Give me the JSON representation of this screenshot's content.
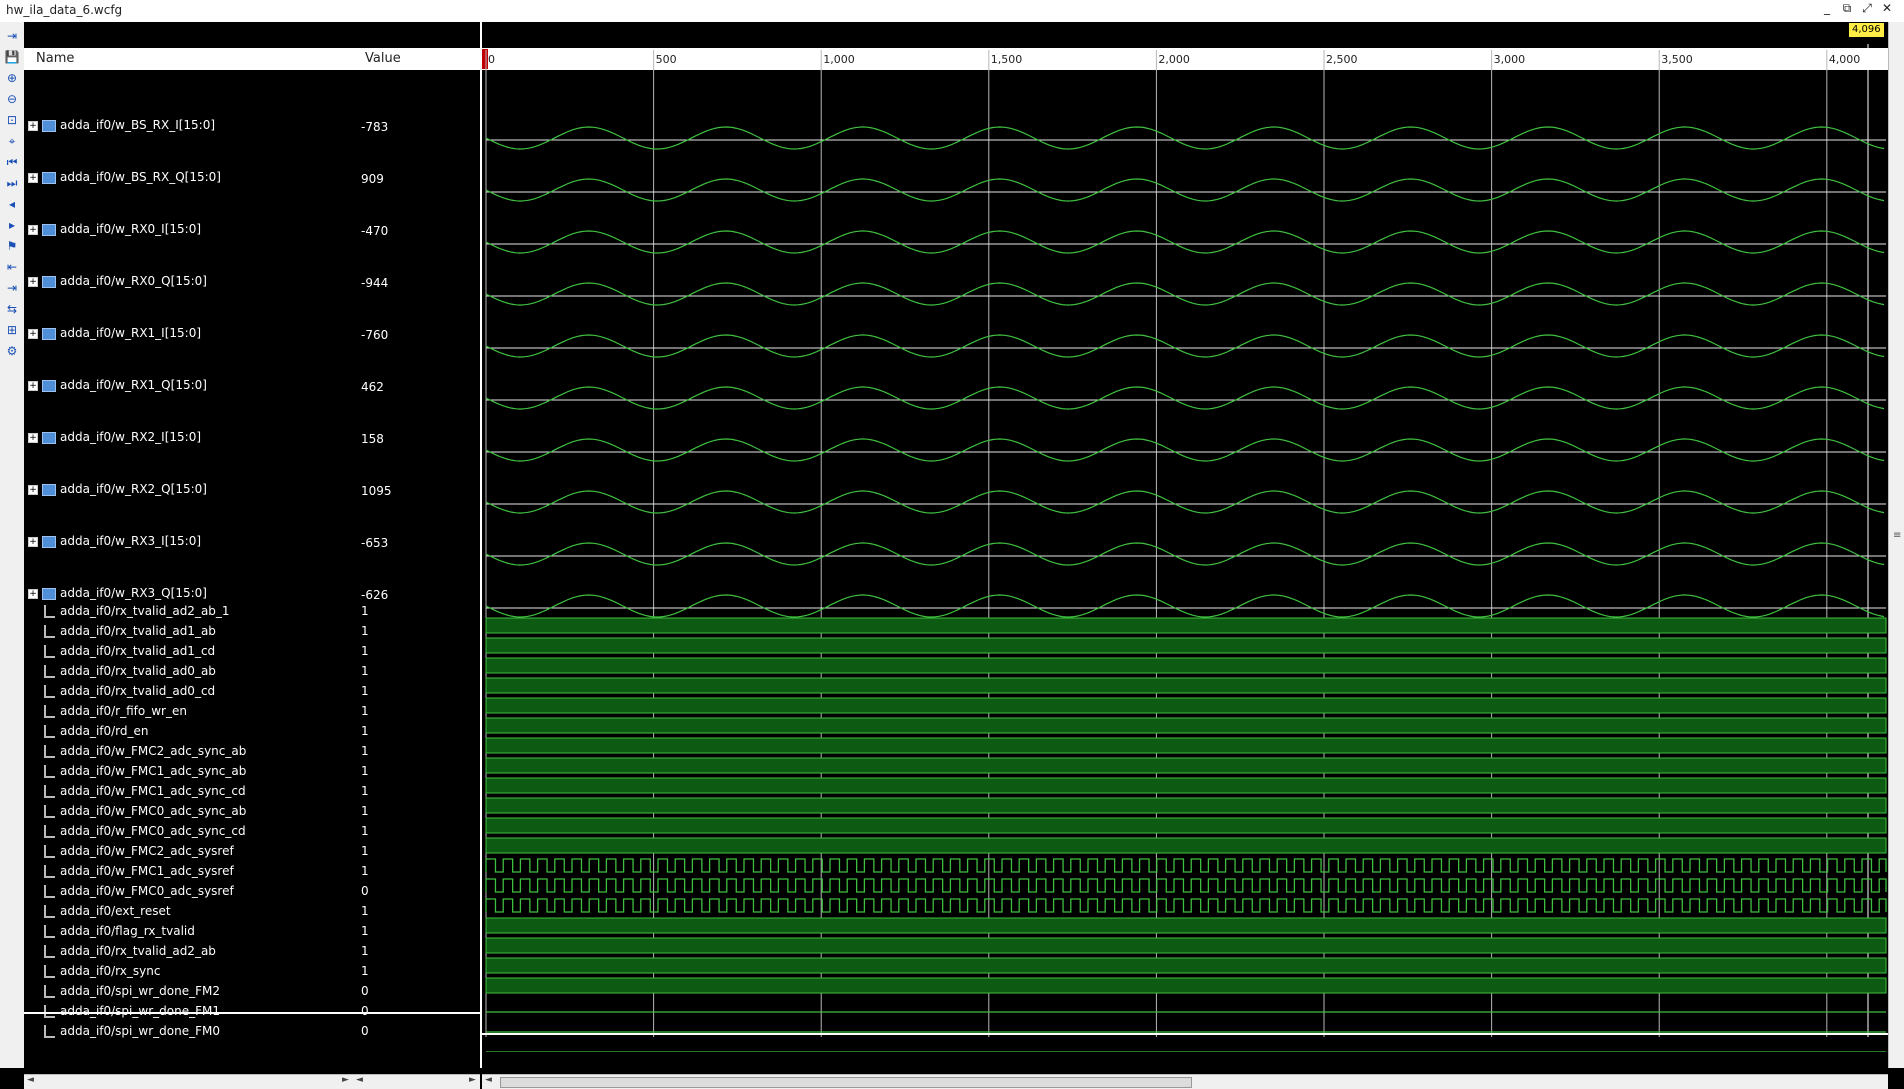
{
  "window": {
    "title": "hw_ila_data_6.wcfg",
    "buttons": [
      "_",
      "⧉",
      "⤢",
      "✕"
    ]
  },
  "columns": {
    "name": "Name",
    "value": "Value"
  },
  "bus_signals": [
    {
      "name": "adda_if0/w_BS_RX_I[15:0]",
      "value": "-783"
    },
    {
      "name": "adda_if0/w_BS_RX_Q[15:0]",
      "value": "909"
    },
    {
      "name": "adda_if0/w_RX0_I[15:0]",
      "value": "-470"
    },
    {
      "name": "adda_if0/w_RX0_Q[15:0]",
      "value": "-944"
    },
    {
      "name": "adda_if0/w_RX1_I[15:0]",
      "value": "-760"
    },
    {
      "name": "adda_if0/w_RX1_Q[15:0]",
      "value": "462"
    },
    {
      "name": "adda_if0/w_RX2_I[15:0]",
      "value": "158"
    },
    {
      "name": "adda_if0/w_RX2_Q[15:0]",
      "value": "1095"
    },
    {
      "name": "adda_if0/w_RX3_I[15:0]",
      "value": "-653"
    },
    {
      "name": "adda_if0/w_RX3_Q[15:0]",
      "value": "-626"
    }
  ],
  "bit_signals": [
    {
      "name": "adda_if0/rx_tvalid_ad2_ab_1",
      "value": "1",
      "kind": "high"
    },
    {
      "name": "adda_if0/rx_tvalid_ad1_ab",
      "value": "1",
      "kind": "high"
    },
    {
      "name": "adda_if0/rx_tvalid_ad1_cd",
      "value": "1",
      "kind": "high"
    },
    {
      "name": "adda_if0/rx_tvalid_ad0_ab",
      "value": "1",
      "kind": "high"
    },
    {
      "name": "adda_if0/rx_tvalid_ad0_cd",
      "value": "1",
      "kind": "high"
    },
    {
      "name": "adda_if0/r_fifo_wr_en",
      "value": "1",
      "kind": "high"
    },
    {
      "name": "adda_if0/rd_en",
      "value": "1",
      "kind": "high"
    },
    {
      "name": "adda_if0/w_FMC2_adc_sync_ab",
      "value": "1",
      "kind": "high"
    },
    {
      "name": "adda_if0/w_FMC1_adc_sync_ab",
      "value": "1",
      "kind": "high"
    },
    {
      "name": "adda_if0/w_FMC1_adc_sync_cd",
      "value": "1",
      "kind": "high"
    },
    {
      "name": "adda_if0/w_FMC0_adc_sync_ab",
      "value": "1",
      "kind": "high"
    },
    {
      "name": "adda_if0/w_FMC0_adc_sync_cd",
      "value": "1",
      "kind": "high"
    },
    {
      "name": "adda_if0/w_FMC2_adc_sysref",
      "value": "1",
      "kind": "clock"
    },
    {
      "name": "adda_if0/w_FMC1_adc_sysref",
      "value": "1",
      "kind": "clock"
    },
    {
      "name": "adda_if0/w_FMC0_adc_sysref",
      "value": "0",
      "kind": "clock"
    },
    {
      "name": "adda_if0/ext_reset",
      "value": "1",
      "kind": "high"
    },
    {
      "name": "adda_if0/flag_rx_tvalid",
      "value": "1",
      "kind": "high"
    },
    {
      "name": "adda_if0/rx_tvalid_ad2_ab",
      "value": "1",
      "kind": "high"
    },
    {
      "name": "adda_if0/rx_sync",
      "value": "1",
      "kind": "high"
    },
    {
      "name": "adda_if0/spi_wr_done_FM2",
      "value": "0",
      "kind": "low"
    },
    {
      "name": "adda_if0/spi_wr_done_FM1",
      "value": "0",
      "kind": "low"
    },
    {
      "name": "adda_if0/spi_wr_done_FM0",
      "value": "0",
      "kind": "low"
    }
  ],
  "timeline": {
    "ticks": [
      0,
      500,
      1000,
      1500,
      2000,
      2500,
      3000,
      3500,
      4000
    ],
    "tick_labels": [
      "0",
      "500",
      "1,000",
      "1,500",
      "2,000",
      "2,500",
      "3,000",
      "3,500",
      "4,000"
    ],
    "max": 4096,
    "cursor_label": "4,096"
  },
  "toolbar_icons": [
    "insert-marker-icon",
    "save-icon",
    "zoom-in-icon",
    "zoom-out-icon",
    "zoom-fit-icon",
    "zoom-cursor-icon",
    "go-start-icon",
    "go-end-icon",
    "prev-transition-icon",
    "next-transition-icon",
    "add-marker-icon",
    "prev-marker-icon",
    "next-marker-icon",
    "swap-cursor-icon",
    "snap-icon",
    "settings-icon"
  ],
  "colors": {
    "wave": "#3fbf3f",
    "fill": "#0d5a12",
    "grid": "#b8b8b8",
    "cursor": "#ffec45",
    "baseline": "#e6e6e6"
  }
}
